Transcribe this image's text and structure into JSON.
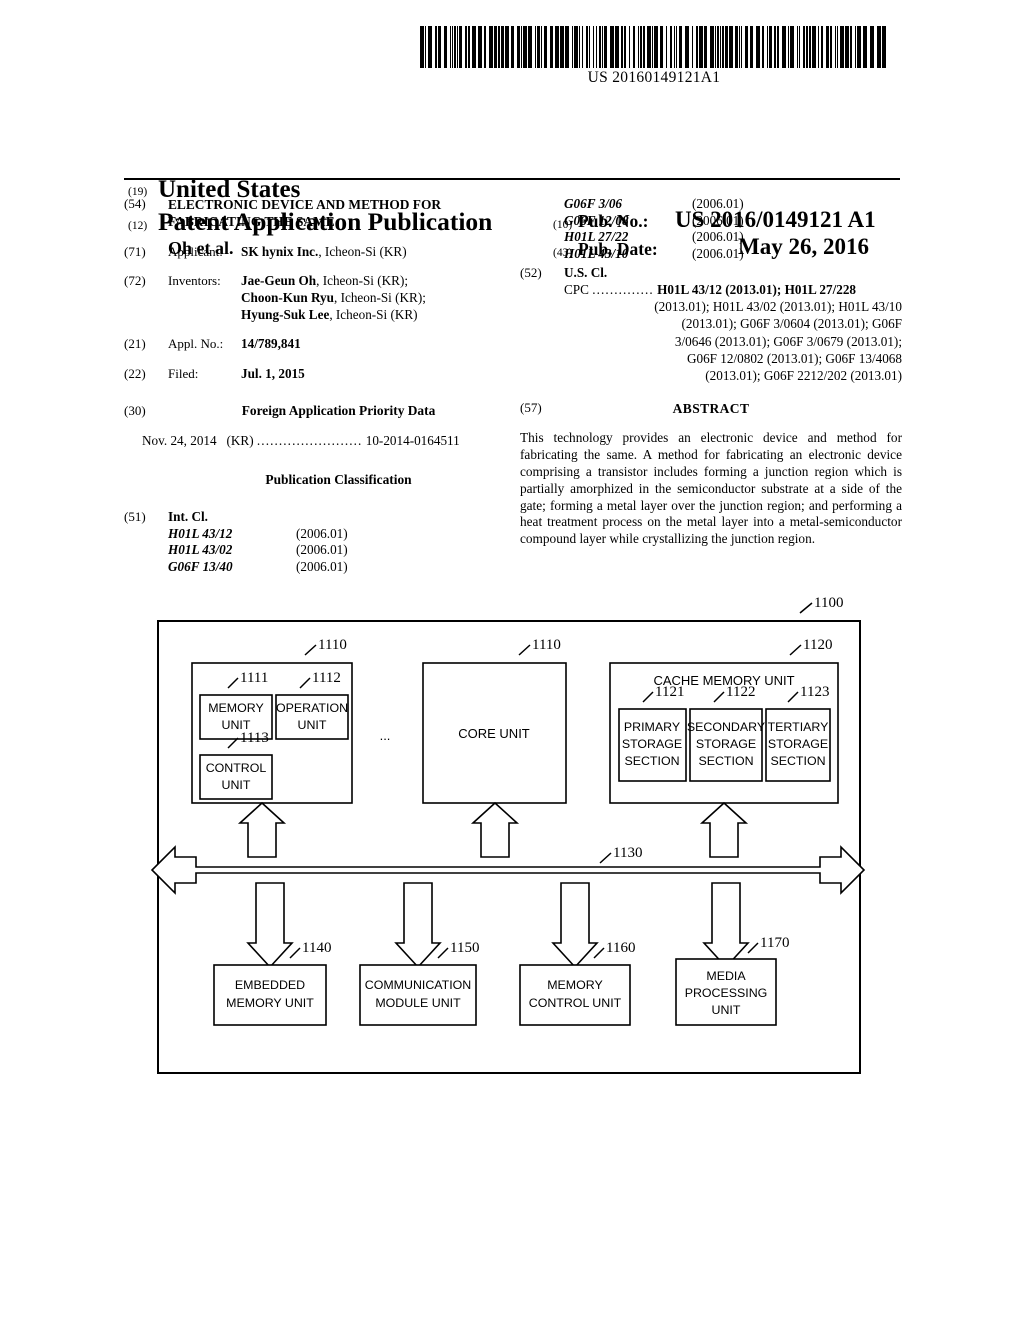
{
  "barcode": {
    "number": "US 20160149121A1"
  },
  "masthead": {
    "kind_19": "(19)",
    "country": "United States",
    "kind_12": "(12)",
    "doc_type": "Patent Application Publication",
    "authors": "Oh et al.",
    "kind_10": "(10)",
    "pub_no_label": "Pub. No.:",
    "pub_no_value": "US 2016/0149121 A1",
    "kind_43": "(43)",
    "pub_date_label": "Pub. Date:",
    "pub_date_value": "May 26, 2016"
  },
  "biblio": {
    "title_num": "(54)",
    "title": "ELECTRONIC DEVICE AND METHOD FOR FABRICATING THE SAME",
    "applicant_num": "(71)",
    "applicant_label": "Applicant:",
    "applicant_name": "SK hynix Inc.",
    "applicant_loc": ", Icheon-Si (KR)",
    "inventors_num": "(72)",
    "inventors_label": "Inventors:",
    "inventors": [
      {
        "name": "Jae-Geun Oh",
        "loc": ", Icheon-Si (KR);"
      },
      {
        "name": "Choon-Kun Ryu",
        "loc": ", Icheon-Si (KR);"
      },
      {
        "name": "Hyung-Suk Lee",
        "loc": ", Icheon-Si (KR)"
      }
    ],
    "appl_no_num": "(21)",
    "appl_no_label": "Appl. No.:",
    "appl_no_value": "14/789,841",
    "filed_num": "(22)",
    "filed_label": "Filed:",
    "filed_value": "Jul. 1, 2015",
    "priority_num": "(30)",
    "priority_heading": "Foreign Application Priority Data",
    "priority_date": "Nov. 24, 2014",
    "priority_country": "(KR)",
    "priority_dots": "........................",
    "priority_number": "10-2014-0164511",
    "pub_class_heading": "Publication Classification",
    "intcl_num": "(51)",
    "intcl_label": "Int. Cl.",
    "intcl_left": [
      {
        "code": "H01L 43/12",
        "date": "(2006.01)"
      },
      {
        "code": "H01L 43/02",
        "date": "(2006.01)"
      },
      {
        "code": "G06F 13/40",
        "date": "(2006.01)"
      }
    ],
    "intcl_right": [
      {
        "code": "G06F 3/06",
        "date": "(2006.01)"
      },
      {
        "code": "G06F 12/08",
        "date": "(2006.01)"
      },
      {
        "code": "H01L 27/22",
        "date": "(2006.01)"
      },
      {
        "code": "H01L 43/10",
        "date": "(2006.01)"
      }
    ],
    "uscl_num": "(52)",
    "uscl_label": "U.S. Cl.",
    "cpc_label": "CPC",
    "cpc_dots": "..............",
    "cpc_lines": [
      "H01L 43/12 (2013.01); H01L 27/228",
      "(2013.01); H01L 43/02 (2013.01); H01L 43/10",
      "(2013.01); G06F 3/0604 (2013.01); G06F",
      "3/0646 (2013.01); G06F 3/0679 (2013.01);",
      "G06F 12/0802 (2013.01); G06F 13/4068",
      "(2013.01); G06F 2212/202 (2013.01)"
    ]
  },
  "abstract": {
    "num": "(57)",
    "title": "ABSTRACT",
    "text": "This technology provides an electronic device and method for fabricating the same. A method for fabricating an electronic device comprising a transistor includes forming a junction region which is partially amorphized in the semiconductor substrate at a side of the gate; forming a metal layer over the junction region; and performing a heat treatment process on the metal layer into a metal-semiconductor compound layer while crystallizing the junction region."
  },
  "figure": {
    "system_ref": "1100",
    "core_unit_a_ref": "1110",
    "core_unit_b_ref": "1110",
    "cache_ref": "1120",
    "memory_unit_ref": "1111",
    "operation_unit_ref": "1112",
    "control_unit_ref": "1113",
    "primary_ref": "1121",
    "secondary_ref": "1122",
    "tertiary_ref": "1123",
    "bus_ref": "1130",
    "embedded_ref": "1140",
    "communication_ref": "1150",
    "memory_control_ref": "1160",
    "media_ref": "1170",
    "ellipsis": "...",
    "labels": {
      "memory_unit_l1": "MEMORY",
      "memory_unit_l2": "UNIT",
      "operation_unit_l1": "OPERATION",
      "operation_unit_l2": "UNIT",
      "control_unit_l1": "CONTROL",
      "control_unit_l2": "UNIT",
      "core_unit": "CORE UNIT",
      "cache_memory_unit": "CACHE MEMORY UNIT",
      "primary_l1": "PRIMARY",
      "primary_l2": "STORAGE",
      "primary_l3": "SECTION",
      "secondary_l1": "SECONDARY",
      "secondary_l2": "STORAGE",
      "secondary_l3": "SECTION",
      "tertiary_l1": "TERTIARY",
      "tertiary_l2": "STORAGE",
      "tertiary_l3": "SECTION",
      "embedded_l1": "EMBEDDED",
      "embedded_l2": "MEMORY UNIT",
      "communication_l1": "COMMUNICATION",
      "communication_l2": "MODULE UNIT",
      "memory_control_l1": "MEMORY",
      "memory_control_l2": "CONTROL UNIT",
      "media_l1": "MEDIA",
      "media_l2": "PROCESSING",
      "media_l3": "UNIT"
    }
  }
}
